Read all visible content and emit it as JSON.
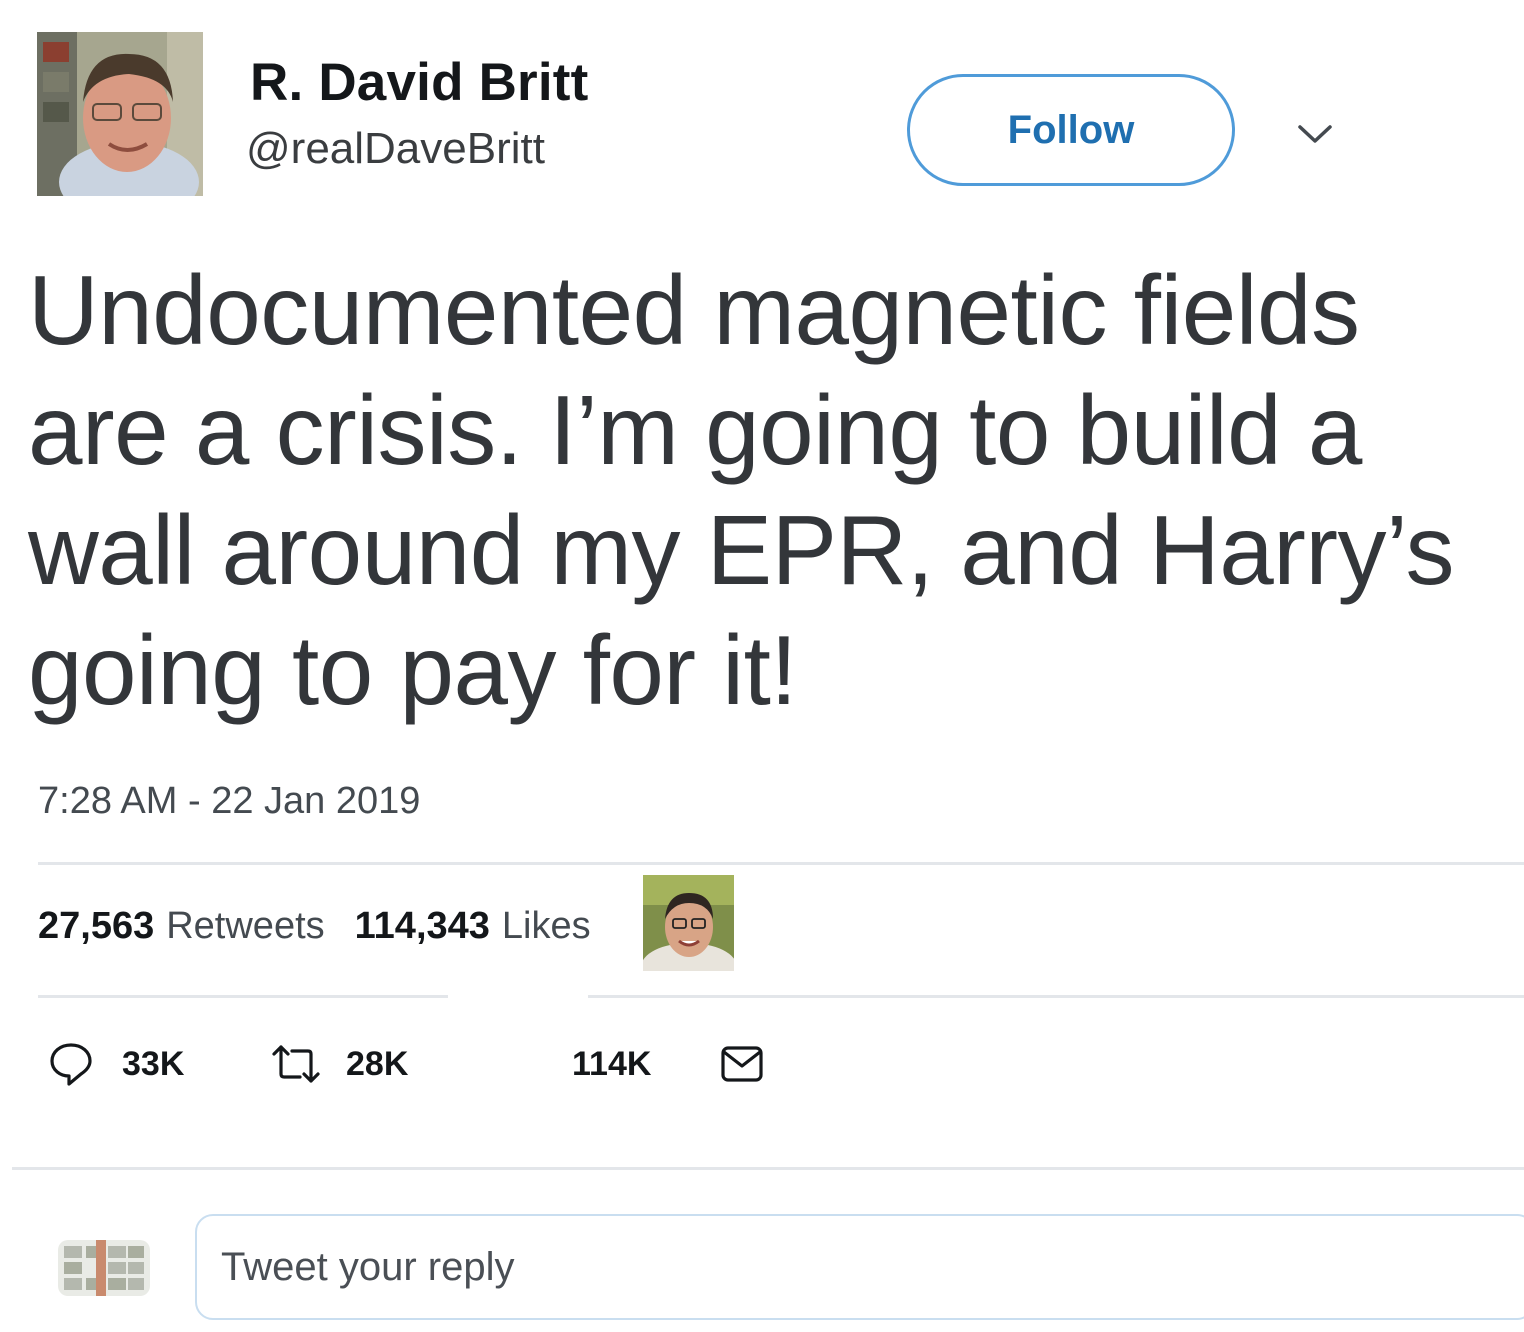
{
  "author": {
    "name": "R. David Britt",
    "handle": "@realDaveBritt",
    "avatar_icon": "author-photo"
  },
  "header": {
    "follow_label": "Follow",
    "more_icon": "chevron-down-icon"
  },
  "tweet": {
    "text": "Undocumented magnetic fields are a crisis. I’m going to build a wall around my EPR, and Harry’s going to pay for it!",
    "timestamp": "7:28 AM - 22 Jan 2019"
  },
  "stats": {
    "retweets_count": "27,563",
    "retweets_label": "Retweets",
    "likes_count": "114,343",
    "likes_label": "Likes",
    "liker_avatar_icon": "liker-photo"
  },
  "actions": {
    "reply_count": "33K",
    "retweet_count": "28K",
    "like_count": "114K",
    "reply_icon": "reply-icon",
    "retweet_icon": "retweet-icon",
    "message_icon": "envelope-icon"
  },
  "composer": {
    "placeholder": "Tweet your reply"
  },
  "colors": {
    "follow_blue": "#1f6fb0",
    "follow_border": "#4f9bd9",
    "divider": "#e3e6ea",
    "text_dark": "#14171a",
    "tweet_text": "#33363a"
  }
}
